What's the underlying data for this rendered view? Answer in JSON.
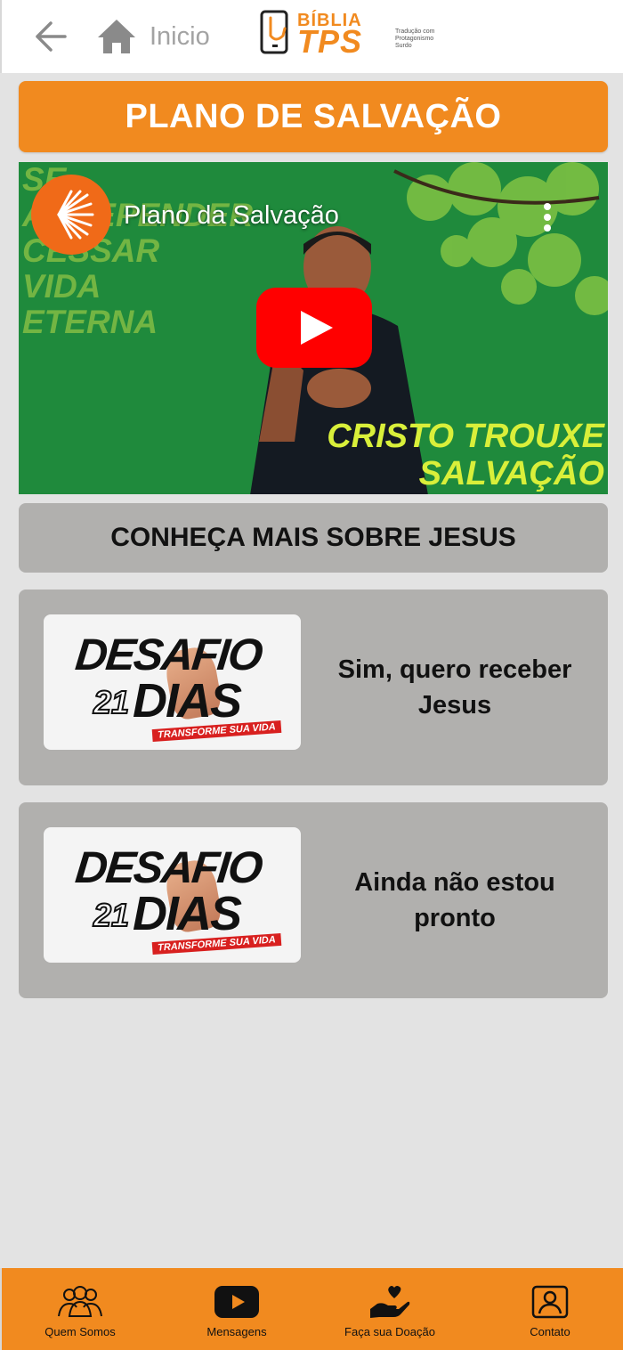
{
  "header": {
    "home_label": "Inicio",
    "logo_word_top": "BÍBLIA",
    "logo_word_main": "TPS",
    "logo_tagline": "Tradução com Protagonismo Surdo"
  },
  "title_banner": "PLANO DE SALVAÇÃO",
  "video": {
    "title": "Plano da Salvação",
    "background_text_left": "SE ARREPENDER CESSAR VIDA ETERNA",
    "background_text_right_1": "CRISTO TROUXE",
    "background_text_right_2": "SALVAÇÃO"
  },
  "section_heading": "CONHEÇA MAIS SOBRE JESUS",
  "cards": [
    {
      "label": "Sim, quero receber Jesus",
      "thumb_title": "DESAFIO",
      "thumb_number": "21",
      "thumb_word": "DIAS",
      "thumb_ribbon": "TRANSFORME SUA VIDA"
    },
    {
      "label": "Ainda não estou pronto",
      "thumb_title": "DESAFIO",
      "thumb_number": "21",
      "thumb_word": "DIAS",
      "thumb_ribbon": "TRANSFORME SUA VIDA"
    }
  ],
  "bottom_nav": [
    {
      "label": "Quem Somos",
      "icon": "people-icon"
    },
    {
      "label": "Mensagens",
      "icon": "youtube-icon"
    },
    {
      "label": "Faça sua Doação",
      "icon": "donate-heart-hand-icon"
    },
    {
      "label": "Contato",
      "icon": "contact-card-icon"
    }
  ],
  "colors": {
    "accent_orange": "#f18a1f",
    "card_gray": "#b1b0ae",
    "page_bg": "#e3e3e3",
    "video_green": "#1f8a3c",
    "youtube_red": "#ff0000"
  }
}
